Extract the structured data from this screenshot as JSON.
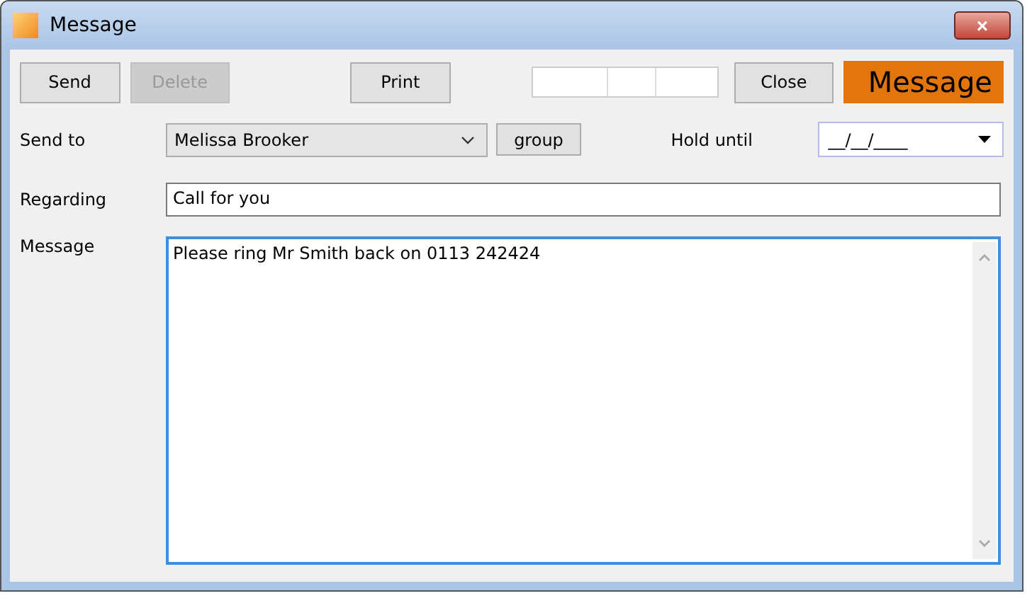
{
  "window": {
    "title": "Message",
    "close": "×"
  },
  "toolbar": {
    "buttons": [
      {
        "label": "Send",
        "disabled": false
      },
      {
        "label": "Delete",
        "disabled": true
      },
      {
        "label": "Print",
        "disabled": false
      }
    ],
    "close_button": {
      "label": "Close"
    },
    "header": "Message"
  },
  "send_to": {
    "label": "Send to",
    "value": "Melissa Brooker",
    "group_button": "group"
  },
  "hold_until": {
    "label": "Hold until",
    "value": "__/__/____"
  },
  "regarding": {
    "label": "Regarding",
    "value": "Call for you"
  },
  "message": {
    "label": "Message",
    "value": "Please ring Mr Smith back on 0113 242424"
  }
}
